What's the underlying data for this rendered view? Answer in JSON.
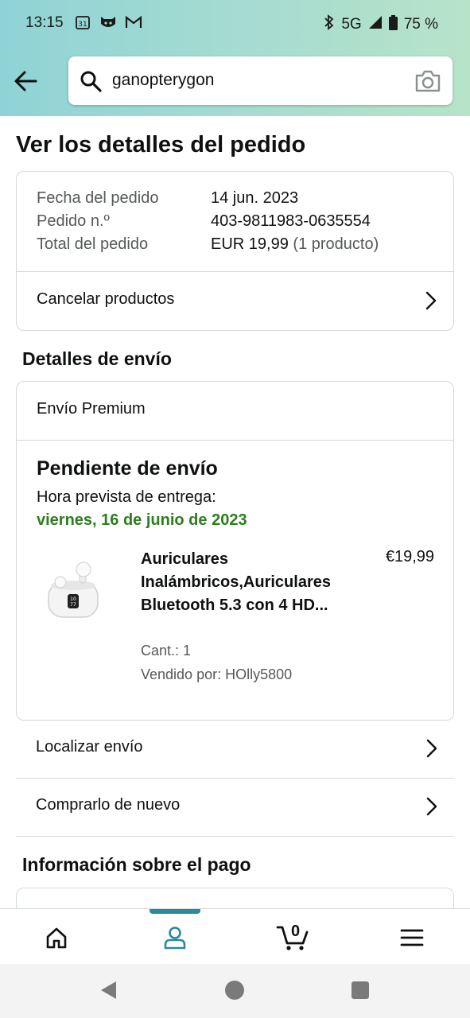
{
  "status_bar": {
    "time": "13:15",
    "network": "5G",
    "battery": "75 %"
  },
  "search": {
    "query": "ganopterygon"
  },
  "page": {
    "title": "Ver los detalles del pedido"
  },
  "order": {
    "date_label": "Fecha del pedido",
    "date_value": "14 jun. 2023",
    "number_label": "Pedido n.º",
    "number_value": "403-9811983-0635554",
    "total_label": "Total del pedido",
    "total_value": "EUR 19,99",
    "total_count": "(1 producto)",
    "cancel_label": "Cancelar productos"
  },
  "shipping": {
    "section_title": "Detalles de envío",
    "method": "Envío Premium",
    "status": "Pendiente de envío",
    "eta_label": "Hora prevista de entrega:",
    "eta_date": "viernes, 16 de junio de 2023",
    "product": {
      "title": "Auriculares Inalámbricos,Auriculares Bluetooth 5.3 con 4 HD...",
      "price": "€19,99",
      "quantity": "Cant.: 1",
      "seller": "Vendido por: HOlly5800"
    },
    "track_label": "Localizar envío",
    "buy_again_label": "Comprarlo de nuevo"
  },
  "payment": {
    "section_title": "Información sobre el pago"
  },
  "bottom_nav": {
    "cart_count": "0"
  },
  "colors": {
    "accent": "#2a8a9e",
    "delivery_green": "#2e7d1f"
  }
}
